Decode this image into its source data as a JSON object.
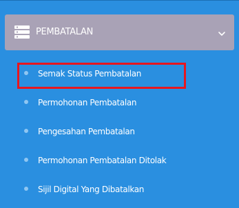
{
  "menu": {
    "title": "PEMBATALAN",
    "icon": "list-icon",
    "expand_icon": "chevron-down-icon",
    "items": [
      {
        "label": "Semak Status Pembatalan",
        "highlighted": true
      },
      {
        "label": "Permohonan Pembatalan"
      },
      {
        "label": "Pengesahan Pembatalan"
      },
      {
        "label": "Permohonan Pembatalan Ditolak"
      },
      {
        "label": "Sijil Digital Yang Dibatalkan"
      }
    ]
  },
  "colors": {
    "panel_background": "#2a8fe0",
    "header_background": "#a9a2b6",
    "bullet": "#8fc6f2",
    "highlight_border": "#e8161f",
    "text": "#ffffff"
  }
}
